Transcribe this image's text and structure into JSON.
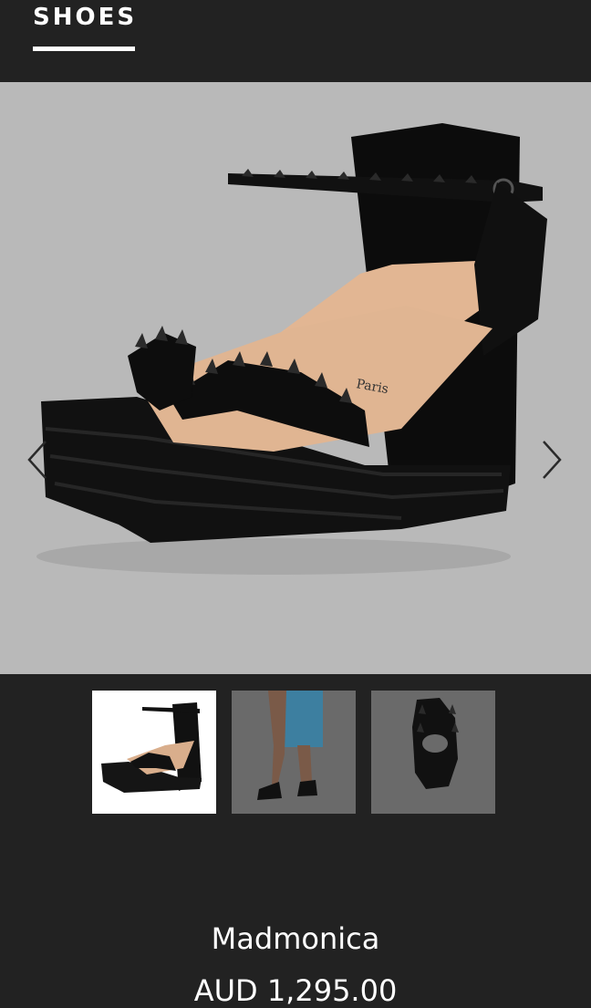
{
  "header": {
    "tab_title": "SHOES"
  },
  "gallery": {
    "main_image_icon": "wedge-sandal-image",
    "prev_icon": "chevron-left-icon",
    "next_icon": "chevron-right-icon",
    "thumbnails": [
      {
        "icon": "sandal-side-thumbnail",
        "selected": true
      },
      {
        "icon": "model-wearing-sandal-thumbnail",
        "selected": false
      },
      {
        "icon": "sandal-back-thumbnail",
        "selected": false
      }
    ]
  },
  "product": {
    "name": "Madmonica",
    "price": "AUD 1,295.00"
  },
  "colors": {
    "background": "#222222",
    "hero_background": "#b9b9b9",
    "text": "#ffffff"
  }
}
